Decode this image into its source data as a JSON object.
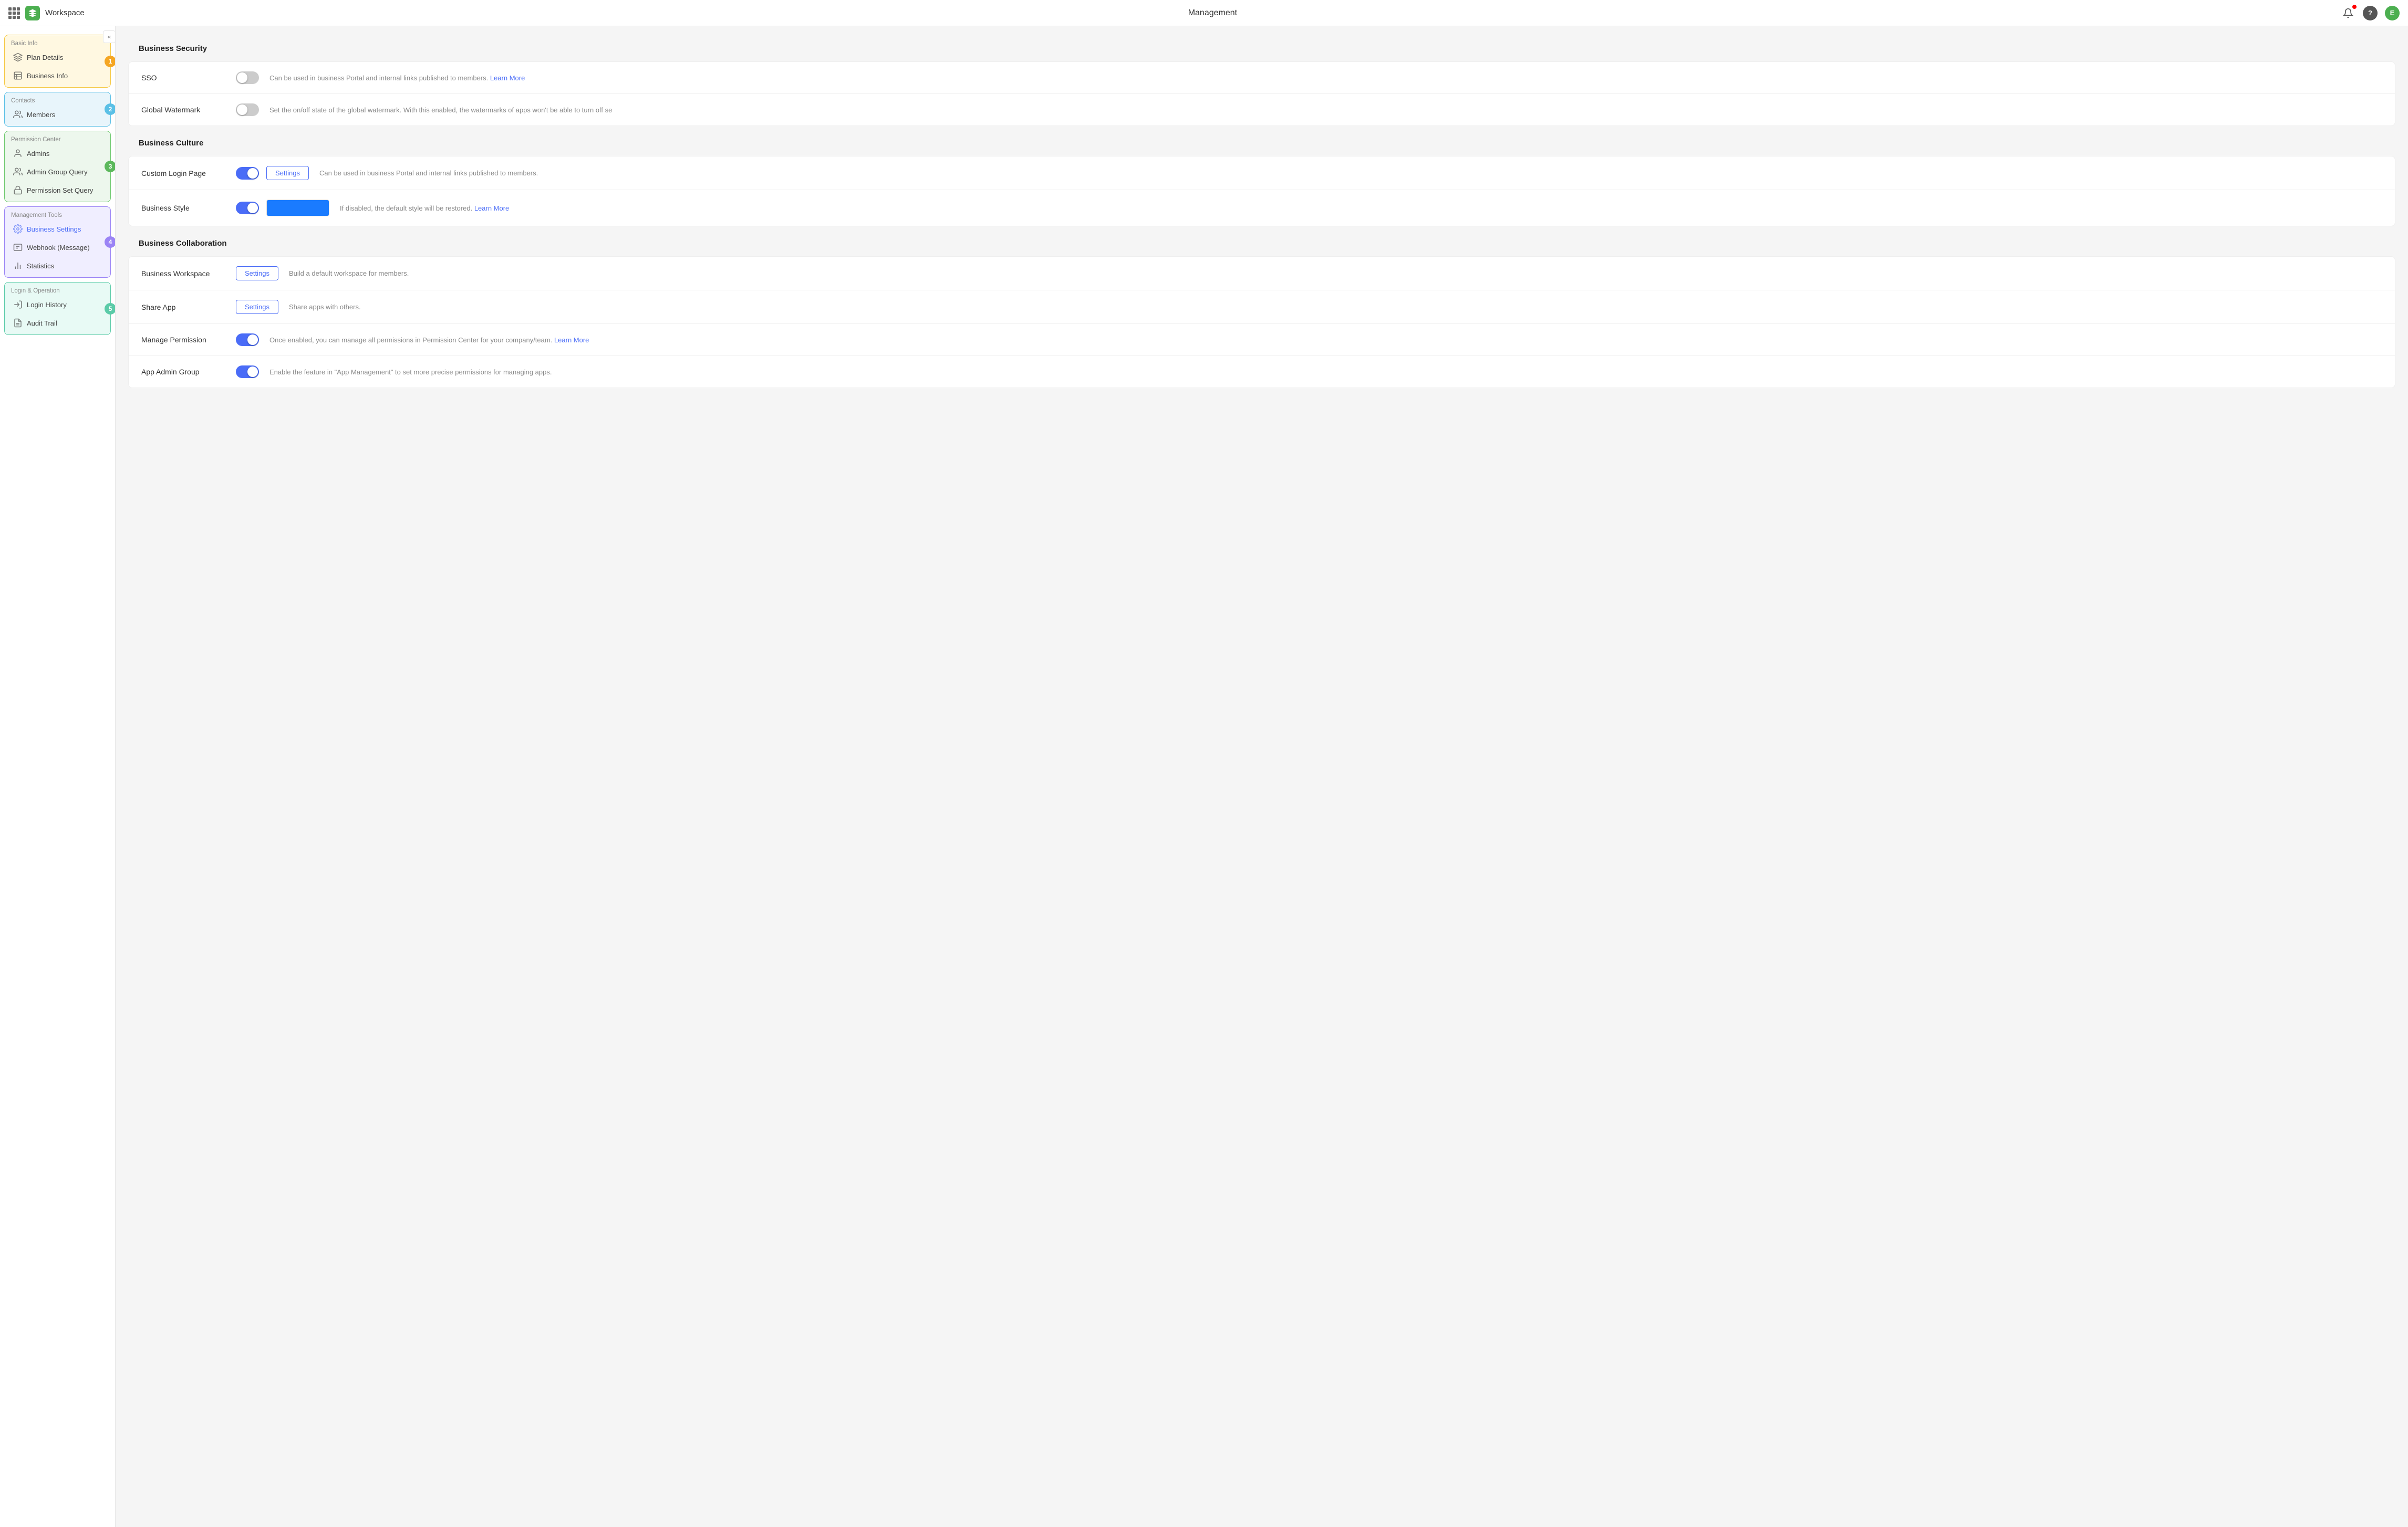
{
  "header": {
    "app_name": "Workspace",
    "page_title": "Management",
    "user_initial": "E",
    "grid_icon": "grid-icon",
    "bell_icon": "bell-icon",
    "help_icon": "help-icon",
    "user_icon": "user-avatar-icon"
  },
  "sidebar": {
    "collapse_label": "«",
    "blocks": [
      {
        "id": "basic-info",
        "title": "Basic Info",
        "badge": "1",
        "badge_color": "#f5a623",
        "items": [
          {
            "id": "plan-details",
            "label": "Plan Details",
            "icon": "layers-icon"
          },
          {
            "id": "business-info",
            "label": "Business Info",
            "icon": "table-icon"
          }
        ]
      },
      {
        "id": "contacts",
        "title": "Contacts",
        "badge": "2",
        "badge_color": "#5bc0e6",
        "items": [
          {
            "id": "members",
            "label": "Members",
            "icon": "members-icon"
          }
        ]
      },
      {
        "id": "permission",
        "title": "Permission Center",
        "badge": "3",
        "badge_color": "#5cb85c",
        "items": [
          {
            "id": "admins",
            "label": "Admins",
            "icon": "admin-icon"
          },
          {
            "id": "admin-group-query",
            "label": "Admin Group Query",
            "icon": "admin-group-icon"
          },
          {
            "id": "permission-set-query",
            "label": "Permission Set Query",
            "icon": "lock-icon"
          }
        ]
      },
      {
        "id": "management",
        "title": "Management Tools",
        "badge": "4",
        "badge_color": "#9b84f5",
        "items": [
          {
            "id": "business-settings",
            "label": "Business Settings",
            "icon": "settings-icon",
            "active": true
          },
          {
            "id": "webhook",
            "label": "Webhook (Message)",
            "icon": "webhook-icon"
          },
          {
            "id": "statistics",
            "label": "Statistics",
            "icon": "stats-icon"
          }
        ]
      },
      {
        "id": "login",
        "title": "Login & Operation",
        "badge": "5",
        "badge_color": "#5bcba8",
        "items": [
          {
            "id": "login-history",
            "label": "Login History",
            "icon": "login-icon"
          },
          {
            "id": "audit-trail",
            "label": "Audit Trail",
            "icon": "audit-icon"
          }
        ]
      }
    ]
  },
  "main": {
    "sections": [
      {
        "id": "business-security",
        "title": "Business Security",
        "rows": [
          {
            "id": "sso",
            "label": "SSO",
            "toggle": "off",
            "has_settings_btn": false,
            "description": "Can be used in business Portal and internal links published to members.",
            "link_text": "Learn More",
            "link_href": "#"
          },
          {
            "id": "global-watermark",
            "label": "Global Watermark",
            "toggle": "off",
            "has_settings_btn": false,
            "description": "Set the on/off state of the global watermark. With this enabled, the watermarks of apps won't be able to turn off se",
            "link_text": "",
            "link_href": ""
          }
        ]
      },
      {
        "id": "business-culture",
        "title": "Business Culture",
        "rows": [
          {
            "id": "custom-login-page",
            "label": "Custom Login Page",
            "toggle": "on",
            "has_settings_btn": true,
            "settings_label": "Settings",
            "description": "Can be used in business Portal and internal links published to members.",
            "link_text": "",
            "link_href": ""
          },
          {
            "id": "business-style",
            "label": "Business Style",
            "toggle": "on",
            "has_settings_btn": false,
            "has_color_swatch": true,
            "description": "If disabled, the default style will be restored.",
            "link_text": "Learn More",
            "link_href": "#"
          }
        ]
      },
      {
        "id": "business-collaboration",
        "title": "Business Collaboration",
        "rows": [
          {
            "id": "business-workspace",
            "label": "Business Workspace",
            "toggle": null,
            "has_settings_btn": true,
            "settings_label": "Settings",
            "description": "Build a default workspace for members.",
            "link_text": "",
            "link_href": ""
          },
          {
            "id": "share-app",
            "label": "Share App",
            "toggle": null,
            "has_settings_btn": true,
            "settings_label": "Settings",
            "description": "Share apps with others.",
            "link_text": "",
            "link_href": ""
          },
          {
            "id": "manage-permission",
            "label": "Manage Permission",
            "toggle": "on",
            "has_settings_btn": false,
            "description": "Once enabled, you can manage all permissions in Permission Center for your company/team.",
            "link_text": "Learn More",
            "link_href": "#"
          },
          {
            "id": "app-admin-group",
            "label": "App Admin Group",
            "toggle": "on",
            "has_settings_btn": false,
            "description": "Enable the feature in \"App Management\" to set more precise permissions for managing apps.",
            "link_text": "",
            "link_href": ""
          }
        ]
      }
    ]
  }
}
